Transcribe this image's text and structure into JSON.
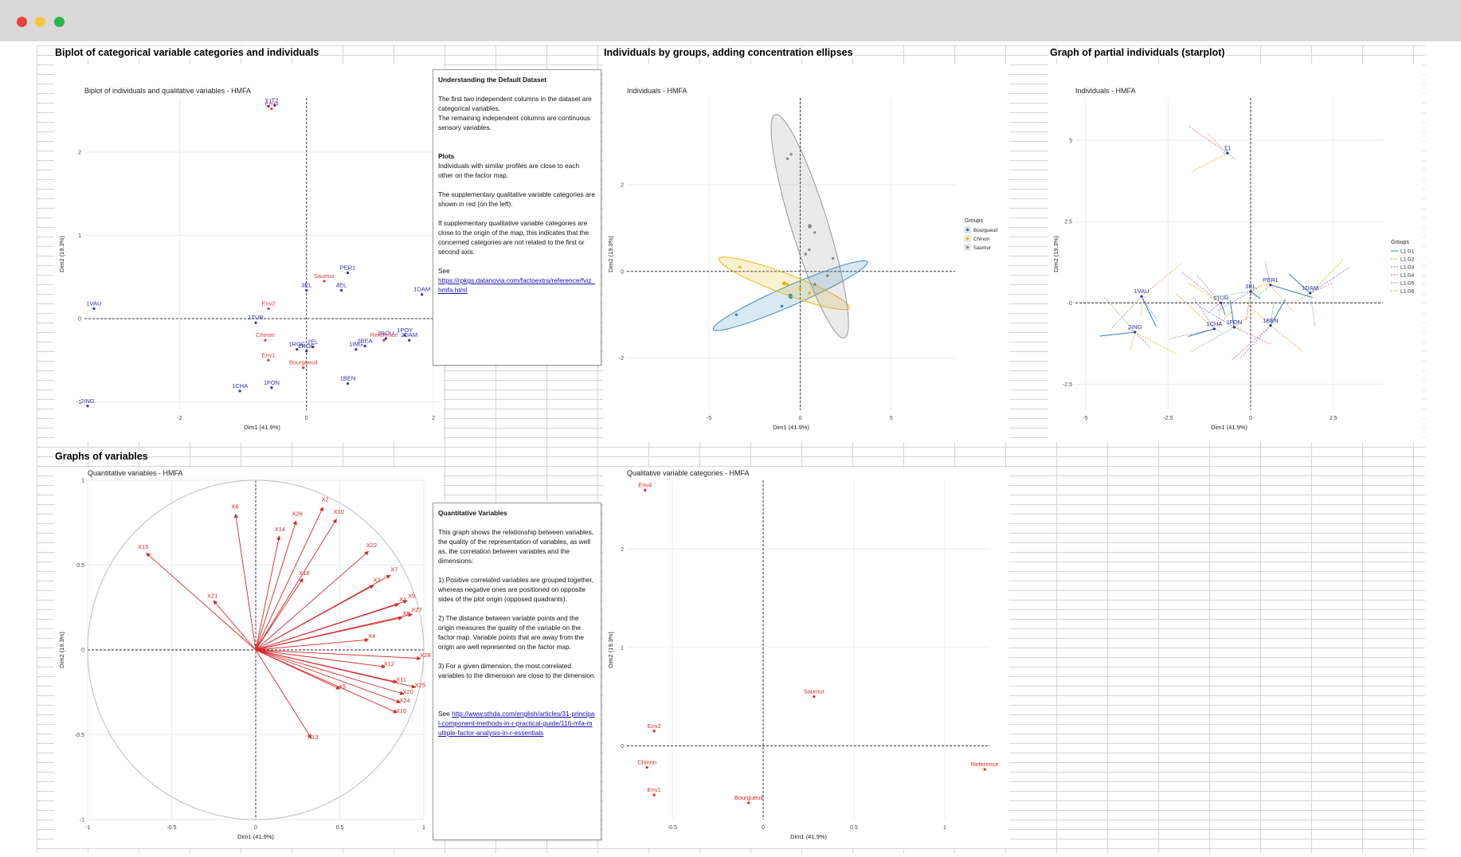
{
  "window": {
    "controls": [
      "close",
      "minimize",
      "maximize"
    ],
    "colors": {
      "close": "#e8413d",
      "minimize": "#f5c73a",
      "maximize": "#2fb34a",
      "titlebar": "#d9d9d9"
    }
  },
  "sections": {
    "biplot": "Biplot of categorical variable categories and individuals",
    "groups": "Individuals by groups, adding concentration ellipses",
    "partial": "Graph of partial individuals (starplot)",
    "variables": "Graphs of variables"
  },
  "notes": {
    "dataset": {
      "title": "Understanding the Default Dataset",
      "intro": "The first two independent columns in the dataset are categorical variables.\nThe remaining independent columns are continuous sensory variables.",
      "plots_heading": "Plots",
      "p1": "Individuals with similar profiles are close to each other on the factor map.",
      "p2": "The supplementary qualitative variable categories are shown in red (on the left).",
      "p3": "If supplementary qualitative variable categories are close to the origin of the map, this indicates that the concerned categories are not related to the first or second axis.",
      "see": "See",
      "link": "https://rpkgs.datanovia.com/factoextra/reference/fviz_hmfa.html"
    },
    "quant": {
      "title": "Quantitative Variables",
      "intro": "This graph shows the relationship between variables, the quality of the representation of variables, as well as, the correlation between variables and the dimensions:",
      "p1": "1) Positive correlated variables are grouped together, whereas negative ones are positioned on opposite sides of the plot origin (opposed quadrants).",
      "p2": "2) The distance between variable points and the origin measures the quality of the variable on the factor map. Variable points that are away from the origin are well represented on the factor map.",
      "p3": "3) For a given dimension, the most correlated variables to the dimension are close to the dimension.",
      "see": "See",
      "link": "http://www.sthda.com/english/articles/31-principal-component-methods-in-r-practical-guide/116-mfa-multiple-factor-analysis-in-r-essentials"
    }
  },
  "chart_data": [
    {
      "id": "biplot",
      "type": "scatter",
      "title": "Biplot of individuals and qualitative variables - HMFA",
      "xlabel": "Dim1 (41.9%)",
      "ylabel": "Dim2 (19.3%)",
      "xlim": [
        -3.5,
        2.1
      ],
      "ylim": [
        -1.1,
        2.65
      ],
      "x_ticks": [
        -2,
        0,
        2
      ],
      "y_ticks": [
        -1,
        0,
        1,
        2
      ],
      "series": [
        {
          "name": "individuals",
          "color": "#2b2fb3",
          "points": [
            {
              "label": "T1",
              "x": -0.6,
              "y": 2.55
            },
            {
              "label": "T2",
              "x": -0.5,
              "y": 2.56
            },
            {
              "label": "1VAU",
              "x": -3.35,
              "y": 0.12
            },
            {
              "label": "2ING",
              "x": -3.45,
              "y": -1.05
            },
            {
              "label": "1TUR",
              "x": -0.8,
              "y": -0.05
            },
            {
              "label": "3EL",
              "x": 0.0,
              "y": 0.34
            },
            {
              "label": "4EL",
              "x": 0.55,
              "y": 0.34
            },
            {
              "label": "PER1",
              "x": 0.65,
              "y": 0.55
            },
            {
              "label": "1DAM",
              "x": 1.82,
              "y": 0.29
            },
            {
              "label": "1POY",
              "x": 1.55,
              "y": -0.2
            },
            {
              "label": "2DAM",
              "x": 1.62,
              "y": -0.26
            },
            {
              "label": "1ROC",
              "x": -0.15,
              "y": -0.37
            },
            {
              "label": "2ROC",
              "x": 0.0,
              "y": -0.39
            },
            {
              "label": "2EL",
              "x": 0.1,
              "y": -0.34
            },
            {
              "label": "1ING",
              "x": 0.78,
              "y": -0.37
            },
            {
              "label": "2BEA",
              "x": 0.92,
              "y": -0.33
            },
            {
              "label": "1BEN",
              "x": 0.65,
              "y": -0.78
            },
            {
              "label": "1FON",
              "x": -0.55,
              "y": -0.83
            },
            {
              "label": "1CHA",
              "x": -1.05,
              "y": -0.87
            },
            {
              "label": "2BOU",
              "x": 1.25,
              "y": -0.24
            }
          ]
        },
        {
          "name": "categories",
          "color": "#e03a3a",
          "points": [
            {
              "label": "Saumur",
              "x": 0.28,
              "y": 0.45
            },
            {
              "label": "Env2",
              "x": -0.6,
              "y": 0.12
            },
            {
              "label": "Chinon",
              "x": -0.65,
              "y": -0.26
            },
            {
              "label": "Env1",
              "x": -0.6,
              "y": -0.5
            },
            {
              "label": "Bourgueuil",
              "x": -0.05,
              "y": -0.59
            },
            {
              "label": "Reference",
              "x": 1.22,
              "y": -0.26
            },
            {
              "label": "Env4",
              "x": -0.55,
              "y": 2.52
            }
          ]
        }
      ]
    },
    {
      "id": "groups",
      "type": "scatter",
      "title": "Individuals - HMFA",
      "xlabel": "Dim1 (41.9%)",
      "ylabel": "Dim2 (19.3%)",
      "xlim": [
        -9.5,
        8.5
      ],
      "ylim": [
        -3.2,
        4.0
      ],
      "x_ticks": [
        -5,
        0,
        5
      ],
      "y_ticks": [
        -2,
        0,
        2
      ],
      "legend": {
        "title": "Groups",
        "position": "right",
        "items": [
          {
            "name": "Bourgueuil",
            "color": "#2b83ba"
          },
          {
            "name": "Chinon",
            "color": "#e6b400"
          },
          {
            "name": "Saumur",
            "color": "#8c8c8c"
          }
        ]
      },
      "series": [
        {
          "name": "Bourgueuil",
          "color": "#2b83ba",
          "points": [
            [
              -3.5,
              -1.0
            ],
            [
              -1.0,
              -0.8
            ],
            [
              -0.5,
              -0.6
            ],
            [
              0.8,
              -0.3
            ],
            [
              1.5,
              -0.1
            ]
          ]
        },
        {
          "name": "Chinon",
          "color": "#e6b400",
          "points": [
            [
              -3.3,
              0.1
            ],
            [
              -0.7,
              -0.3
            ],
            [
              0.0,
              -0.4
            ],
            [
              0.5,
              -0.5
            ]
          ]
        },
        {
          "name": "Saumur",
          "color": "#8c8c8c",
          "points": [
            [
              -0.7,
              2.6
            ],
            [
              -0.5,
              2.7
            ],
            [
              0.3,
              0.4
            ],
            [
              0.5,
              0.5
            ],
            [
              1.8,
              0.3
            ],
            [
              1.5,
              -0.1
            ],
            [
              0.8,
              0.9
            ]
          ]
        }
      ]
    },
    {
      "id": "partial",
      "type": "scatter",
      "title": "Individuals - HMFA",
      "xlabel": "Dim1 (41.9%)",
      "ylabel": "Dim2 (19.3%)",
      "xlim": [
        -5.3,
        4.0
      ],
      "ylim": [
        -3.3,
        6.3
      ],
      "x_ticks": [
        -5.0,
        -2.5,
        0.0,
        2.5
      ],
      "y_ticks": [
        -2.5,
        0.0,
        2.5,
        5.0
      ],
      "legend": {
        "title": "Groups",
        "position": "right",
        "items": [
          {
            "name": "L1.G1",
            "color": "#2b83ba"
          },
          {
            "name": "L1.G2",
            "color": "#e6b400"
          },
          {
            "name": "L1.G3",
            "color": "#7a7ad6"
          },
          {
            "name": "L1.G4",
            "color": "#d46a9a"
          },
          {
            "name": "L1.G5",
            "color": "#7ab86a"
          },
          {
            "name": "L1.G6",
            "color": "#e0a040"
          }
        ]
      },
      "labels": [
        {
          "label": "T1",
          "x": -0.7,
          "y": 4.6
        },
        {
          "label": "1VAU",
          "x": -3.3,
          "y": 0.2
        },
        {
          "label": "2ING",
          "x": -3.5,
          "y": -0.9
        },
        {
          "label": "1TUR",
          "x": -0.9,
          "y": 0.0
        },
        {
          "label": "3EL",
          "x": 0.0,
          "y": 0.35
        },
        {
          "label": "PER1",
          "x": 0.6,
          "y": 0.55
        },
        {
          "label": "1DAM",
          "x": 1.8,
          "y": 0.3
        },
        {
          "label": "1CHA",
          "x": -1.1,
          "y": -0.8
        },
        {
          "label": "1FON",
          "x": -0.5,
          "y": -0.75
        },
        {
          "label": "1BEN",
          "x": 0.6,
          "y": -0.7
        }
      ]
    },
    {
      "id": "variables",
      "type": "line",
      "title": "Quantitative variables - HMFA",
      "xlabel": "Dim1 (41.9%)",
      "ylabel": "Dim2 (19.3%)",
      "xlim": [
        -1.0,
        1.0
      ],
      "ylim": [
        -1.0,
        1.0
      ],
      "x_ticks": [
        -1.0,
        -0.5,
        0.0,
        0.5,
        1.0
      ],
      "y_ticks": [
        -1.0,
        -0.5,
        0.0,
        0.5,
        1.0
      ],
      "color": "#d62728",
      "vectors": [
        {
          "label": "X15",
          "x": -0.65,
          "y": 0.57
        },
        {
          "label": "X6",
          "x": -0.12,
          "y": 0.8
        },
        {
          "label": "X26",
          "x": 0.24,
          "y": 0.76
        },
        {
          "label": "X2",
          "x": 0.4,
          "y": 0.84
        },
        {
          "label": "X10",
          "x": 0.48,
          "y": 0.77
        },
        {
          "label": "X14",
          "x": 0.14,
          "y": 0.67
        },
        {
          "label": "X22",
          "x": 0.67,
          "y": 0.58
        },
        {
          "label": "X21",
          "x": -0.25,
          "y": 0.29
        },
        {
          "label": "X18",
          "x": 0.28,
          "y": 0.42
        },
        {
          "label": "X7",
          "x": 0.8,
          "y": 0.44
        },
        {
          "label": "X3",
          "x": 0.7,
          "y": 0.38
        },
        {
          "label": "X9",
          "x": 0.9,
          "y": 0.29
        },
        {
          "label": "X1",
          "x": 0.85,
          "y": 0.27
        },
        {
          "label": "X27",
          "x": 0.93,
          "y": 0.21
        },
        {
          "label": "X8",
          "x": 0.87,
          "y": 0.19
        },
        {
          "label": "X4",
          "x": 0.67,
          "y": 0.06
        },
        {
          "label": "X28",
          "x": 0.98,
          "y": -0.05
        },
        {
          "label": "X12",
          "x": 0.77,
          "y": -0.1
        },
        {
          "label": "X11",
          "x": 0.84,
          "y": -0.19
        },
        {
          "label": "X25",
          "x": 0.95,
          "y": -0.22
        },
        {
          "label": "X20",
          "x": 0.88,
          "y": -0.26
        },
        {
          "label": "X24",
          "x": 0.86,
          "y": -0.31
        },
        {
          "label": "X16",
          "x": 0.84,
          "y": -0.37
        },
        {
          "label": "X5",
          "x": 0.5,
          "y": -0.23
        },
        {
          "label": "X13",
          "x": 0.33,
          "y": -0.52
        }
      ]
    },
    {
      "id": "categories",
      "type": "scatter",
      "title": "Qualitative variable categories - HMFA",
      "xlabel": "Dim1 (41.9%)",
      "ylabel": "Dim2 (19.3%)",
      "xlim": [
        -0.75,
        1.25
      ],
      "ylim": [
        -0.75,
        2.7
      ],
      "x_ticks": [
        -0.5,
        0.0,
        0.5,
        1.0
      ],
      "y_ticks": [
        0,
        1,
        2
      ],
      "color": "#d62728",
      "points": [
        {
          "label": "Env4",
          "x": -0.65,
          "y": 2.6
        },
        {
          "label": "Saumur",
          "x": 0.28,
          "y": 0.5
        },
        {
          "label": "Env2",
          "x": -0.6,
          "y": 0.15
        },
        {
          "label": "Chinon",
          "x": -0.64,
          "y": -0.22
        },
        {
          "label": "Env1",
          "x": -0.6,
          "y": -0.5
        },
        {
          "label": "Bourgueuil",
          "x": -0.08,
          "y": -0.58
        },
        {
          "label": "Reference",
          "x": 1.22,
          "y": -0.24
        }
      ]
    }
  ]
}
